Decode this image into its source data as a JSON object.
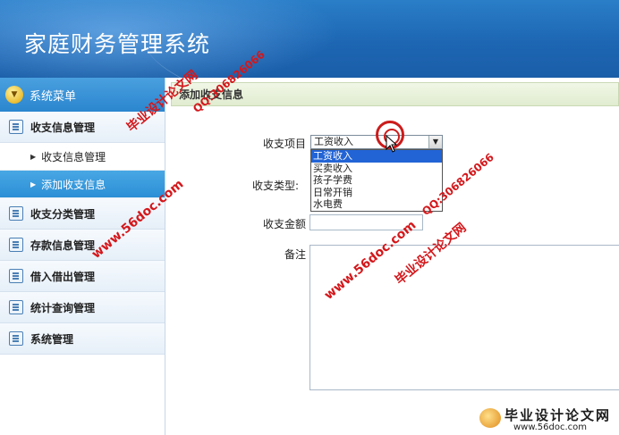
{
  "header": {
    "title": "家庭财务管理系统"
  },
  "sidebar": {
    "head": "系统菜单",
    "groups": [
      {
        "label": "收支信息管理"
      },
      {
        "label": "收支分类管理"
      },
      {
        "label": "存款信息管理"
      },
      {
        "label": "借入借出管理"
      },
      {
        "label": "统计查询管理"
      },
      {
        "label": "系统管理"
      }
    ],
    "subs": [
      {
        "label": "收支信息管理"
      },
      {
        "label": "添加收支信息"
      }
    ]
  },
  "main": {
    "title": "添加收支信息",
    "form": {
      "item_label": "收支项目",
      "item_selected": "工资收入",
      "type_label": "收支类型:",
      "amount_label": "收支金额",
      "note_label": "备注",
      "options": [
        "工资收入",
        "买卖收入",
        "孩子学费",
        "日常开销",
        "水电费"
      ]
    }
  },
  "watermarks": {
    "site": "www.56doc.com",
    "qq": "QQ:306826066",
    "name": "毕业设计论文网",
    "brand_title": "毕业设计论文网",
    "brand_url": "www.56doc.com"
  }
}
